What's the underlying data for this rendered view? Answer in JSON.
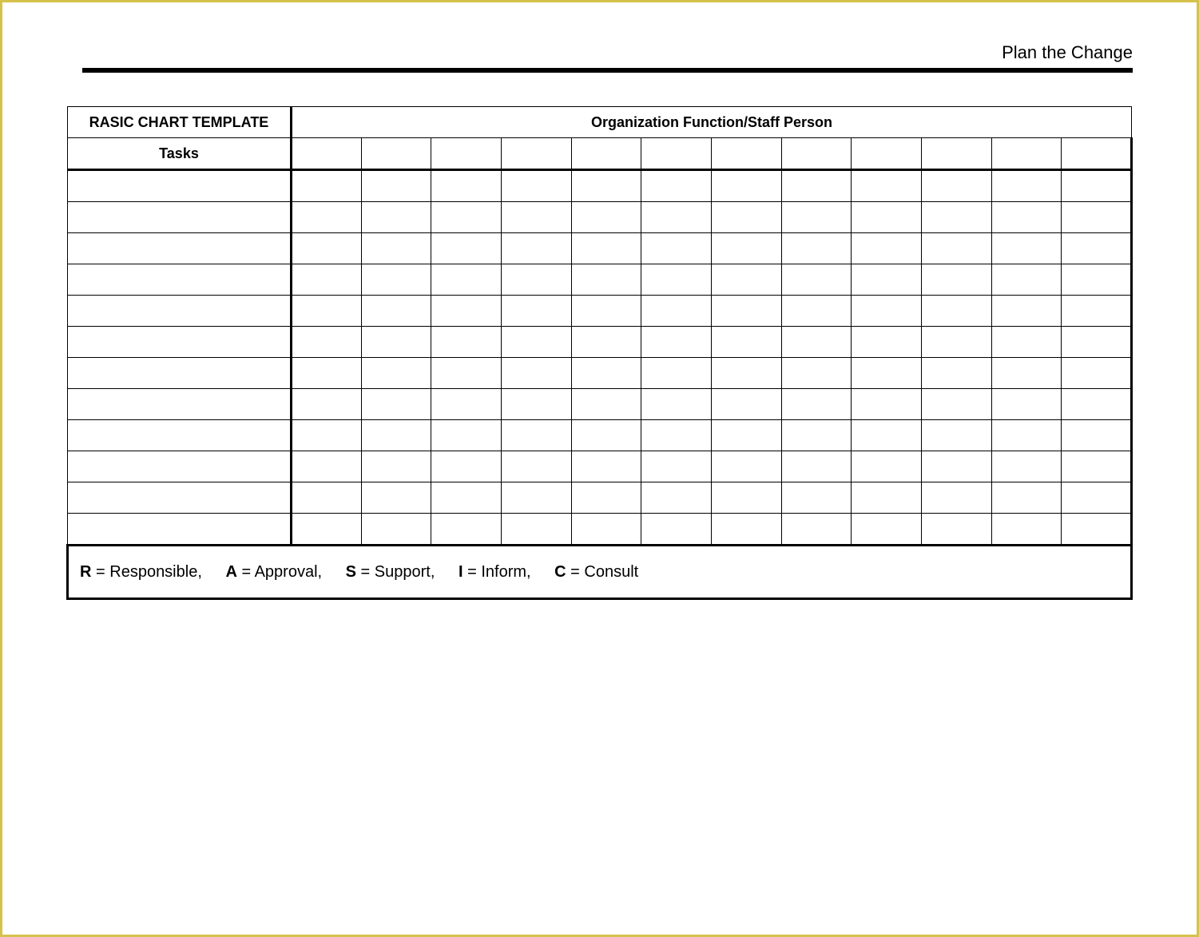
{
  "header": {
    "right_label": "Plan the Change"
  },
  "chart": {
    "title": "RASIC CHART TEMPLATE",
    "org_header": "Organization Function/Staff Person",
    "tasks_header": "Tasks",
    "num_columns": 12,
    "tasks": [
      "",
      "",
      "",
      "",
      "",
      "",
      "",
      "",
      "",
      "",
      "",
      ""
    ]
  },
  "legend": {
    "items": [
      {
        "code": "R",
        "label": "Responsible,"
      },
      {
        "code": "A",
        "label": "Approval,"
      },
      {
        "code": "S",
        "label": "Support,"
      },
      {
        "code": "I",
        "label": "Inform,"
      },
      {
        "code": "C",
        "label": "Consult"
      }
    ]
  },
  "chart_data": {
    "type": "table",
    "title": "RASIC CHART TEMPLATE",
    "columns_group": "Organization Function/Staff Person",
    "row_header": "Tasks",
    "column_headers": [
      "",
      "",
      "",
      "",
      "",
      "",
      "",
      "",
      "",
      "",
      "",
      ""
    ],
    "rows": [
      [
        "",
        "",
        "",
        "",
        "",
        "",
        "",
        "",
        "",
        "",
        "",
        "",
        ""
      ],
      [
        "",
        "",
        "",
        "",
        "",
        "",
        "",
        "",
        "",
        "",
        "",
        "",
        ""
      ],
      [
        "",
        "",
        "",
        "",
        "",
        "",
        "",
        "",
        "",
        "",
        "",
        "",
        ""
      ],
      [
        "",
        "",
        "",
        "",
        "",
        "",
        "",
        "",
        "",
        "",
        "",
        "",
        ""
      ],
      [
        "",
        "",
        "",
        "",
        "",
        "",
        "",
        "",
        "",
        "",
        "",
        "",
        ""
      ],
      [
        "",
        "",
        "",
        "",
        "",
        "",
        "",
        "",
        "",
        "",
        "",
        "",
        ""
      ],
      [
        "",
        "",
        "",
        "",
        "",
        "",
        "",
        "",
        "",
        "",
        "",
        "",
        ""
      ],
      [
        "",
        "",
        "",
        "",
        "",
        "",
        "",
        "",
        "",
        "",
        "",
        "",
        ""
      ],
      [
        "",
        "",
        "",
        "",
        "",
        "",
        "",
        "",
        "",
        "",
        "",
        "",
        ""
      ],
      [
        "",
        "",
        "",
        "",
        "",
        "",
        "",
        "",
        "",
        "",
        "",
        "",
        ""
      ],
      [
        "",
        "",
        "",
        "",
        "",
        "",
        "",
        "",
        "",
        "",
        "",
        "",
        ""
      ],
      [
        "",
        "",
        "",
        "",
        "",
        "",
        "",
        "",
        "",
        "",
        "",
        "",
        ""
      ]
    ],
    "legend": "R = Responsible, A = Approval, S = Support, I = Inform, C = Consult"
  }
}
